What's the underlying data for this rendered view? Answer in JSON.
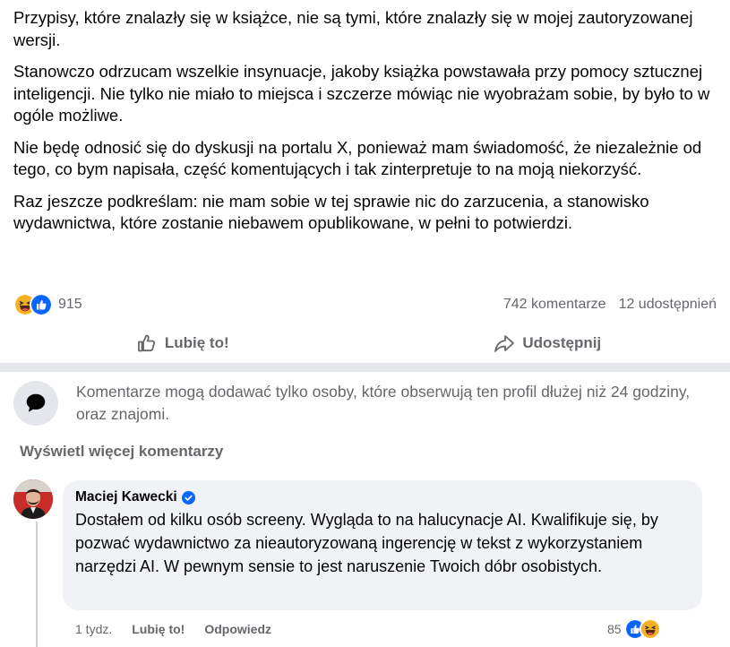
{
  "post": {
    "paragraphs": [
      "Przypisy, które znalazły się w książce, nie są tymi, które znalazły się w mojej zautoryzowanej wersji.",
      "Stanowczo odrzucam wszelkie insynuacje, jakoby książka powstawała przy pomocy sztucznej inteligencji. Nie tylko nie miało to miejsca i szczerze mówiąc nie wyobrażam sobie, by było to w ogóle możliwe.",
      "Nie będę odnosić się do dyskusji na portalu X, ponieważ mam świadomość, że niezależnie od tego, co bym napisała, część komentujących i tak zinterpretuje to na moją niekorzyść.",
      "Raz jeszcze podkreślam: nie mam sobie w tej sprawie nic do zarzucenia, a stanowisko wydawnictwa, które zostanie niebawem opublikowane, w pełni to potwierdzi."
    ],
    "reactions": {
      "icons": [
        "haha-emoji-icon",
        "like-emoji-icon"
      ],
      "count": "915"
    },
    "comments_count": "742 komentarze",
    "shares_count": "12 udostępnień"
  },
  "actions": {
    "like_label": "Lubię to!",
    "share_label": "Udostępnij"
  },
  "restriction": {
    "icon": "speech-bubble-icon",
    "text": "Komentarze mogą dodawać tylko osoby, które obserwują ten profil dłużej niż 24 godziny, oraz znajomi."
  },
  "more_comments_label": "Wyświetl więcej komentarzy",
  "comment": {
    "author": "Maciej Kawecki",
    "verified": true,
    "text": "Dostałem od kilku osób screeny. Wygląda to na halucynacje AI. Kwalifikuje się, by pozwać wydawnictwo za nieautoryzowaną ingerencję w tekst z wykorzystaniem narzędzi AI. W pewnym sensie to jest naruszenie Twoich dóbr osobistych.",
    "time": "1 tydz.",
    "like_label": "Lubię to!",
    "reply_label": "Odpowiedz",
    "reaction_count": "85"
  },
  "colors": {
    "accent": "#0866ff",
    "secondary_text": "#65676b",
    "bubble_bg": "#f0f2f5",
    "separator": "#e4e6eb"
  }
}
